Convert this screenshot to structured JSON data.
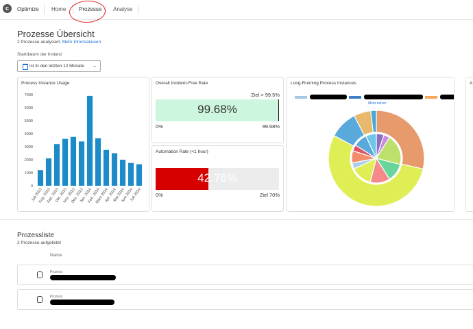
{
  "app": {
    "brand": "Optimize"
  },
  "nav": {
    "tabs": [
      "Home",
      "Prozesse",
      "Analyse"
    ]
  },
  "page": {
    "title": "Prozesse Übersicht",
    "subtitle_count": "2 Prozesse analysiert.",
    "more_info": "Mehr Informationen",
    "start_label": "Startdatum der Instanz",
    "date_filter": "ist In den letzten 12 Monate"
  },
  "cards": {
    "usage": {
      "title": "Process Instance Usage"
    },
    "incident": {
      "title": "Overall Incident-Free Rate",
      "target": "Ziel > 99.5%",
      "value_text": "99.68%",
      "value": 99.68,
      "min": "0%",
      "max": "99.68%"
    },
    "automation": {
      "title": "Automation Rate (<1 hour)",
      "value_text": "42.76%",
      "value": 42.76,
      "min": "0%",
      "max": "Ziel 70%"
    },
    "longrunning": {
      "title": "Long-Running Process Instances",
      "see_more": "Mehr sehen"
    },
    "partial": {
      "title": "A"
    }
  },
  "colors": {
    "bar": "#1e8bc9",
    "green": "#cdf6df",
    "red": "#d60000",
    "grey": "#ececec",
    "accent": "#1f6fd1"
  },
  "chart_data": [
    {
      "type": "bar",
      "title": "Process Instance Usage",
      "categories": [
        "Juli 2023",
        "Aug. 2023",
        "Sep. 2023",
        "Okt. 2023",
        "Nov. 2023",
        "Dez. 2023",
        "Jan. 2024",
        "Feb. 2024",
        "März 2024",
        "Apr. 2024",
        "Mai 2024",
        "Juni 2024",
        "Juli 2024"
      ],
      "values": [
        1200,
        2100,
        3200,
        3600,
        3750,
        3400,
        6900,
        3650,
        2750,
        2500,
        2000,
        1750,
        1650
      ],
      "ylim": [
        0,
        7000
      ],
      "yticks": [
        0,
        1000,
        2000,
        3000,
        4000,
        5000,
        6000,
        7000
      ],
      "grid": false
    },
    {
      "type": "pie",
      "title": "Long-Running Process Instances",
      "outer": [
        {
          "value": 30,
          "color": "#e79a6c"
        },
        {
          "value": 57,
          "color": "#dfee55"
        },
        {
          "value": 10,
          "color": "#5aa9dc"
        },
        {
          "value": 6,
          "color": "#e8b86c"
        },
        {
          "value": 2,
          "color": "#4aa8d8"
        }
      ],
      "inner": [
        {
          "value": 5,
          "color": "#8b6fc0"
        },
        {
          "value": 4,
          "color": "#c78ee0"
        },
        {
          "value": 20,
          "color": "#bde06a"
        },
        {
          "value": 12,
          "color": "#68d69a"
        },
        {
          "value": 13,
          "color": "#f48a8a"
        },
        {
          "value": 14,
          "color": "#dfee55"
        },
        {
          "value": 4,
          "color": "#aacfe8"
        },
        {
          "value": 8,
          "color": "#f28c6a"
        },
        {
          "value": 4,
          "color": "#e05060"
        },
        {
          "value": 9,
          "color": "#5aa9dc"
        },
        {
          "value": 7,
          "color": "#6ec6e8"
        }
      ],
      "legend": [
        "#a5c8ea",
        "#3b7fc4",
        "#f6a85c"
      ]
    }
  ],
  "list": {
    "title": "Prozessliste",
    "subtitle": "2 Prozesse aufgelistet",
    "column": "Name",
    "rows": [
      {
        "type": "Prozess"
      },
      {
        "type": "Prozess"
      }
    ]
  }
}
